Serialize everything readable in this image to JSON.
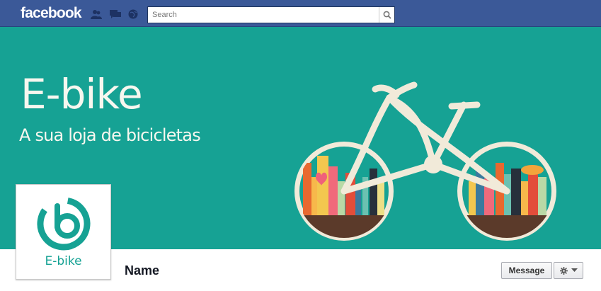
{
  "topbar": {
    "logo": "facebook",
    "search_placeholder": "Search",
    "icons": [
      "friend-requests-icon",
      "messages-icon",
      "notifications-icon",
      "search-icon"
    ]
  },
  "cover": {
    "title": "E-bike",
    "subtitle": "A sua loja de bicicletas",
    "background_color": "#16a294"
  },
  "profile": {
    "name": "E-bike",
    "brand_color": "#16a294"
  },
  "page": {
    "name": "Name",
    "message_label": "Message",
    "settings_icons": [
      "gear-icon",
      "chevron-down-icon"
    ]
  }
}
